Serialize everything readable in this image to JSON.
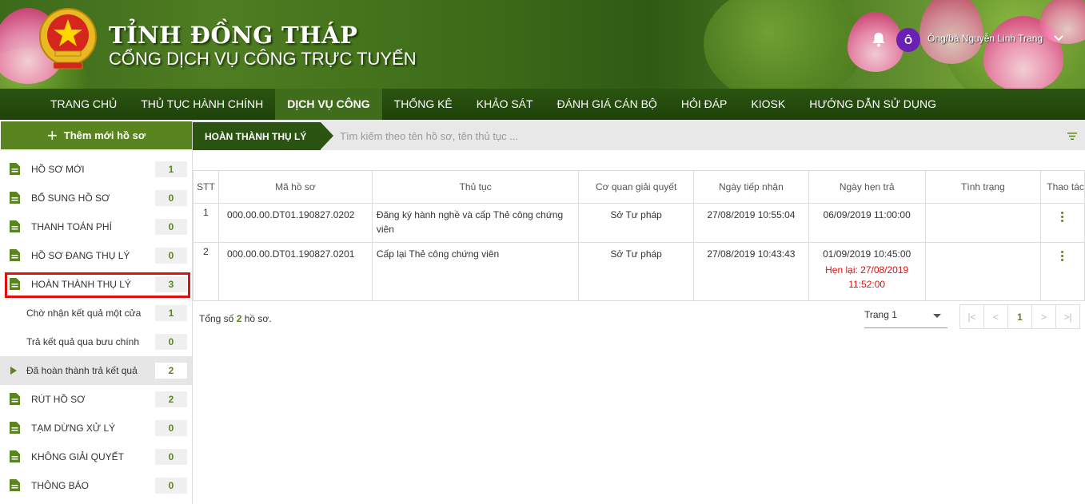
{
  "header": {
    "title": "TỈNH ĐỒNG THÁP",
    "subtitle": "CỔNG DỊCH VỤ CÔNG TRỰC TUYẾN",
    "avatar_initial": "Ô",
    "username": "Ông/bà Nguyễn Linh Trang"
  },
  "nav": {
    "items": [
      "TRANG CHỦ",
      "THỦ TỤC HÀNH CHÍNH",
      "DỊCH VỤ CÔNG",
      "THỐNG KÊ",
      "KHẢO SÁT",
      "ĐÁNH GIÁ CÁN BỘ",
      "HỎI ĐÁP",
      "KIOSK",
      "HƯỚNG DẪN SỬ DỤNG"
    ],
    "active": "DỊCH VỤ CÔNG"
  },
  "sidebar": {
    "add_label": "Thêm mới hồ sơ",
    "items": [
      {
        "label": "HỒ SƠ MỚI",
        "count": "1"
      },
      {
        "label": "BỔ SUNG HỒ SƠ",
        "count": "0"
      },
      {
        "label": "THANH TOÁN PHÍ",
        "count": "0"
      },
      {
        "label": "HỒ SƠ ĐANG THỤ LÝ",
        "count": "0"
      },
      {
        "label": "HOÀN THÀNH THỤ LÝ",
        "count": "3"
      },
      {
        "label": "Chờ nhận kết quả một cửa",
        "count": "1"
      },
      {
        "label": "Trả kết quả qua bưu chính",
        "count": "0"
      },
      {
        "label": "Đã hoàn thành trả kết quả",
        "count": "2"
      },
      {
        "label": "RÚT HỒ SƠ",
        "count": "2"
      },
      {
        "label": "TẠM DỪNG XỬ LÝ",
        "count": "0"
      },
      {
        "label": "KHÔNG GIẢI QUYẾT",
        "count": "0"
      },
      {
        "label": "THÔNG BÁO",
        "count": "0"
      }
    ]
  },
  "main": {
    "breadcrumb": "HOÀN THÀNH THỤ LÝ",
    "search_placeholder": "Tìm kiếm theo tên hồ sơ, tên thủ tục ...",
    "table": {
      "headers": [
        "STT",
        "Mã hồ sơ",
        "Thủ tục",
        "Cơ quan giải quyết",
        "Ngày tiếp nhận",
        "Ngày hẹn trả",
        "Tình trạng",
        "Thao tác"
      ],
      "rows": [
        {
          "stt": "1",
          "code": "000.00.00.DT01.190827.0202",
          "procedure": "Đăng ký hành nghề và cấp Thẻ công chứng viên",
          "agency": "Sở Tư pháp",
          "received": "27/08/2019 10:55:04",
          "due": "06/09/2019 11:00:00",
          "due_extra": "",
          "status": ""
        },
        {
          "stt": "2",
          "code": "000.00.00.DT01.190827.0201",
          "procedure": "Cấp lại Thẻ công chứng viên",
          "agency": "Sở Tư pháp",
          "received": "27/08/2019 10:43:43",
          "due": "01/09/2019 10:45:00",
          "due_extra": "Hẹn lại: 27/08/2019 11:52:00",
          "status": ""
        }
      ]
    },
    "total_prefix": "Tổng số",
    "total_count": "2",
    "total_suffix": "hồ sơ.",
    "page_select": "Trang 1",
    "pager": {
      "first": "|<",
      "prev": "<",
      "current": "1",
      "next": ">",
      "last": ">|"
    }
  }
}
